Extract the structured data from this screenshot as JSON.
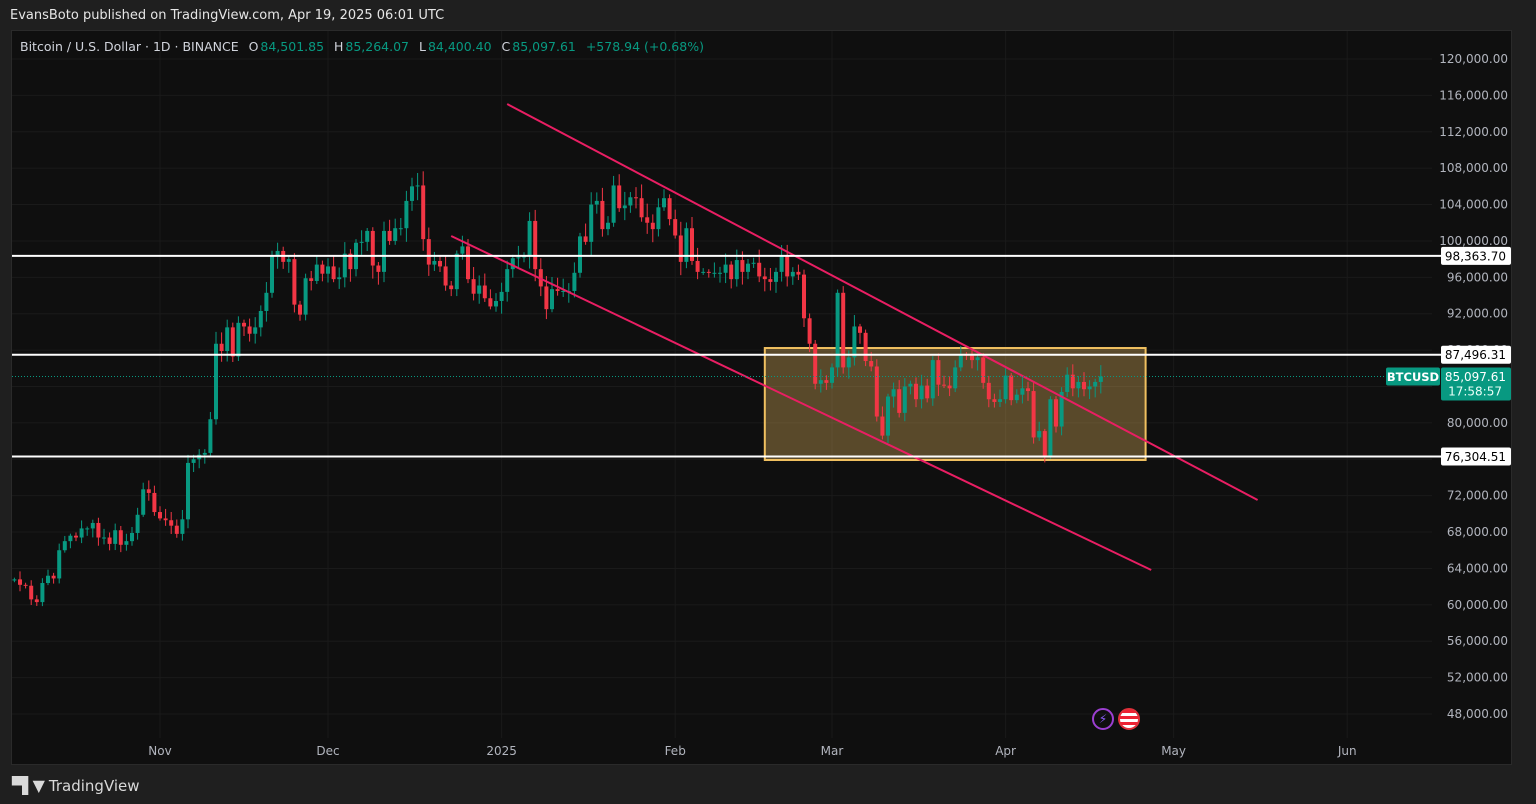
{
  "published": "EvansBoto published on TradingView.com, Apr 19, 2025 06:01 UTC",
  "legend": {
    "symbol": "Bitcoin / U.S. Dollar · 1D · BINANCE",
    "o_label": "O",
    "o": "84,501.85",
    "h_label": "H",
    "h": "85,264.07",
    "l_label": "L",
    "l": "84,400.40",
    "c_label": "C",
    "c": "85,097.61",
    "change": "+578.94 (+0.68%)"
  },
  "footer": {
    "brand": "TradingView",
    "logo": "17"
  },
  "icons": [
    "lightning-icon",
    "us-flag-icon"
  ],
  "colors": {
    "up": "#089981",
    "down": "#f23645",
    "trend": "#e91e63",
    "zone": "#f0c060",
    "level": "#ffffff"
  },
  "chart_data": {
    "type": "candlestick",
    "symbol": "BTCUSD",
    "start_date": "2024-10-06",
    "closes": [
      62800,
      62200,
      62100,
      60600,
      60300,
      62400,
      63200,
      62900,
      66000,
      67000,
      67600,
      67400,
      68400,
      68400,
      69000,
      67400,
      67400,
      66700,
      68200,
      66600,
      67000,
      67900,
      69900,
      72700,
      72300,
      70200,
      69500,
      69300,
      68700,
      67800,
      69400,
      75600,
      76000,
      76500,
      76700,
      80400,
      88700,
      87900,
      90500,
      87300,
      91000,
      90600,
      89800,
      90500,
      92300,
      94300,
      98300,
      98900,
      97700,
      98000,
      93000,
      91900,
      95900,
      95600,
      97400,
      96400,
      97200,
      95800,
      96000,
      98600,
      96900,
      99800,
      99900,
      101100,
      97300,
      96600,
      101100,
      100000,
      101400,
      101400,
      104400,
      106000,
      106100,
      100200,
      97400,
      97800,
      97200,
      95100,
      94700,
      98600,
      99400,
      95800,
      94200,
      95100,
      93700,
      92800,
      93400,
      94400,
      96900,
      98100,
      98200,
      98300,
      102200,
      96900,
      95000,
      92500,
      94700,
      94500,
      94500,
      94500,
      96500,
      100500,
      99900,
      104000,
      104400,
      101300,
      102000,
      106100,
      103600,
      103900,
      104800,
      104700,
      102600,
      102000,
      101300,
      103700,
      104700,
      102400,
      100600,
      97700,
      101400,
      97800,
      96600,
      96600,
      96500,
      96500,
      96500,
      97400,
      95800,
      97900,
      96600,
      97500,
      97600,
      96100,
      95800,
      95500,
      96600,
      98300,
      96100,
      96600,
      96300,
      91500,
      88700,
      84300,
      84700,
      84400,
      86100,
      94300,
      86100,
      87200,
      90600,
      89900,
      86800,
      86200,
      80700,
      78600,
      82900,
      83700,
      81100,
      84000,
      84300,
      82600,
      84100,
      82700,
      86900,
      84200,
      84100,
      83800,
      86100,
      87500,
      87400,
      86900,
      87200,
      84400,
      82600,
      82300,
      82600,
      85200,
      82500,
      83100,
      83800,
      83500,
      78400,
      79100,
      76300,
      82600,
      79600,
      83400,
      85300,
      83800,
      84500,
      83700,
      84000,
      84501.85,
      85097.61
    ],
    "y_ticks": [
      "120,000.00",
      "116,000.00",
      "112,000.00",
      "108,000.00",
      "104,000.00",
      "100,000.00",
      "96,000.00",
      "92,000.00",
      "88,000.00",
      "84,000.00",
      "80,000.00",
      "76,000.00",
      "72,000.00",
      "68,000.00",
      "64,000.00",
      "60,000.00",
      "56,000.00",
      "52,000.00",
      "48,000.00"
    ],
    "y_tick_values": [
      120000,
      116000,
      112000,
      108000,
      104000,
      100000,
      96000,
      92000,
      88000,
      84000,
      80000,
      76000,
      72000,
      68000,
      64000,
      60000,
      56000,
      52000,
      48000
    ],
    "x_ticks": [
      {
        "label": "Nov",
        "day": 26
      },
      {
        "label": "Dec",
        "day": 56
      },
      {
        "label": "2025",
        "day": 87
      },
      {
        "label": "Feb",
        "day": 118
      },
      {
        "label": "Mar",
        "day": 146
      },
      {
        "label": "Apr",
        "day": 177
      },
      {
        "label": "May",
        "day": 207
      },
      {
        "label": "Jun",
        "day": 238
      }
    ],
    "ylim": [
      48000,
      120000
    ],
    "levels": [
      {
        "value": 98363.7,
        "label": "98,363.70"
      },
      {
        "value": 87496.31,
        "label": "87,496.31"
      },
      {
        "value": 76304.51,
        "label": "76,304.51"
      }
    ],
    "trendlines": [
      {
        "name": "upper-channel-line",
        "from": {
          "day": 88,
          "price": 115050
        },
        "to": {
          "day": 222,
          "price": 71520
        }
      },
      {
        "name": "lower-channel-line",
        "from": {
          "day": 78,
          "price": 100540
        },
        "to": {
          "day": 203,
          "price": 63830
        }
      }
    ],
    "zone": {
      "from_day": 134,
      "to_day": 202,
      "top": 88230,
      "bottom": 75920
    },
    "last_price": {
      "tag": "BTCUSD",
      "value": 85097.61,
      "label": "85,097.61",
      "countdown": "17:58:57"
    }
  }
}
